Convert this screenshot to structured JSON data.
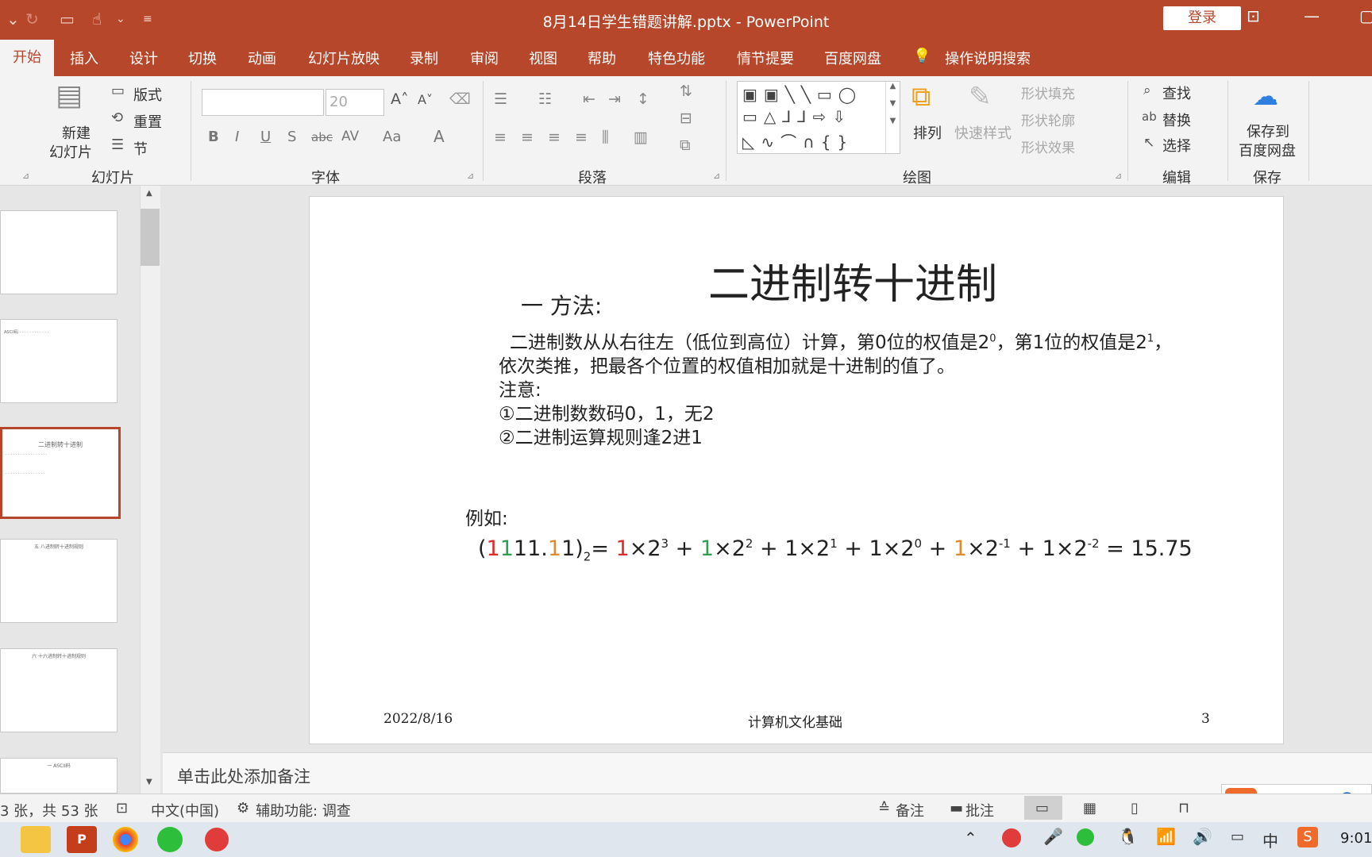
{
  "window": {
    "title": "8月14日学生错题讲解.pptx  -  PowerPoint",
    "login": "登录"
  },
  "tabs": [
    "开始",
    "插入",
    "设计",
    "切换",
    "动画",
    "幻灯片放映",
    "录制",
    "审阅",
    "视图",
    "帮助",
    "特色功能",
    "情节提要",
    "百度网盘",
    "操作说明搜索"
  ],
  "ribbon": {
    "slides": {
      "new_slide": "新建",
      "new_slide2": "幻灯片",
      "layout": "版式",
      "reset": "重置",
      "section": "节",
      "group": "幻灯片"
    },
    "font": {
      "font_size": "20",
      "group": "字体",
      "bold": "B",
      "italic": "I",
      "underline": "U",
      "shadow": "S",
      "strike": "abc",
      "spacing": "AV",
      "case": "Aa",
      "color": "A"
    },
    "paragraph": {
      "group": "段落"
    },
    "drawing": {
      "arrange": "排列",
      "quick_styles": "快速样式",
      "shape_fill": "形状填充",
      "shape_outline": "形状轮廓",
      "shape_effects": "形状效果",
      "group": "绘图"
    },
    "editing": {
      "find": "查找",
      "replace": "替换",
      "select": "选择",
      "group": "编辑"
    },
    "save": {
      "save_to": "保存到",
      "baidu": "百度网盘",
      "group": "保存"
    }
  },
  "slide": {
    "title": "二进制转十进制",
    "method": "一 方法:",
    "body1": "二进制数从从右往左（低位到高位）计算，第0位的权值是2",
    "sup0": "0",
    "body1b": "，第1位的权值是2",
    "sup1": "1",
    "body1c": "，",
    "body2": "依次类推，把最各个位置的权值相加就是十进制的值了。",
    "note_label": "注意:",
    "note1": "①二进制数数码0，1，无2",
    "note2": "②二进制运算规则逢2进1",
    "example_label": "例如:",
    "footer_date": "2022/8/16",
    "footer_center": "计算机文化基础",
    "footer_page": "3"
  },
  "thumbnails": {
    "selected_title": "二进制转十进制",
    "t4_title": "五 八进制转十进制规则",
    "t5_title": "六 十六进制转十进制规则",
    "t6_title": "一 ASCII码"
  },
  "notes_placeholder": "单击此处添加备注",
  "status": {
    "slide_info": "3 张，共 53 张",
    "language": "中文(中国)",
    "accessibility": "辅助功能: 调查",
    "notes": "备注",
    "comments": "批注"
  },
  "taskbar": {
    "time": "9:01",
    "ime_lang": "中"
  },
  "colors": {
    "accent": "#b7472a",
    "red": "#e02b2b",
    "green": "#2e9e4f",
    "orange": "#e08a2e"
  }
}
